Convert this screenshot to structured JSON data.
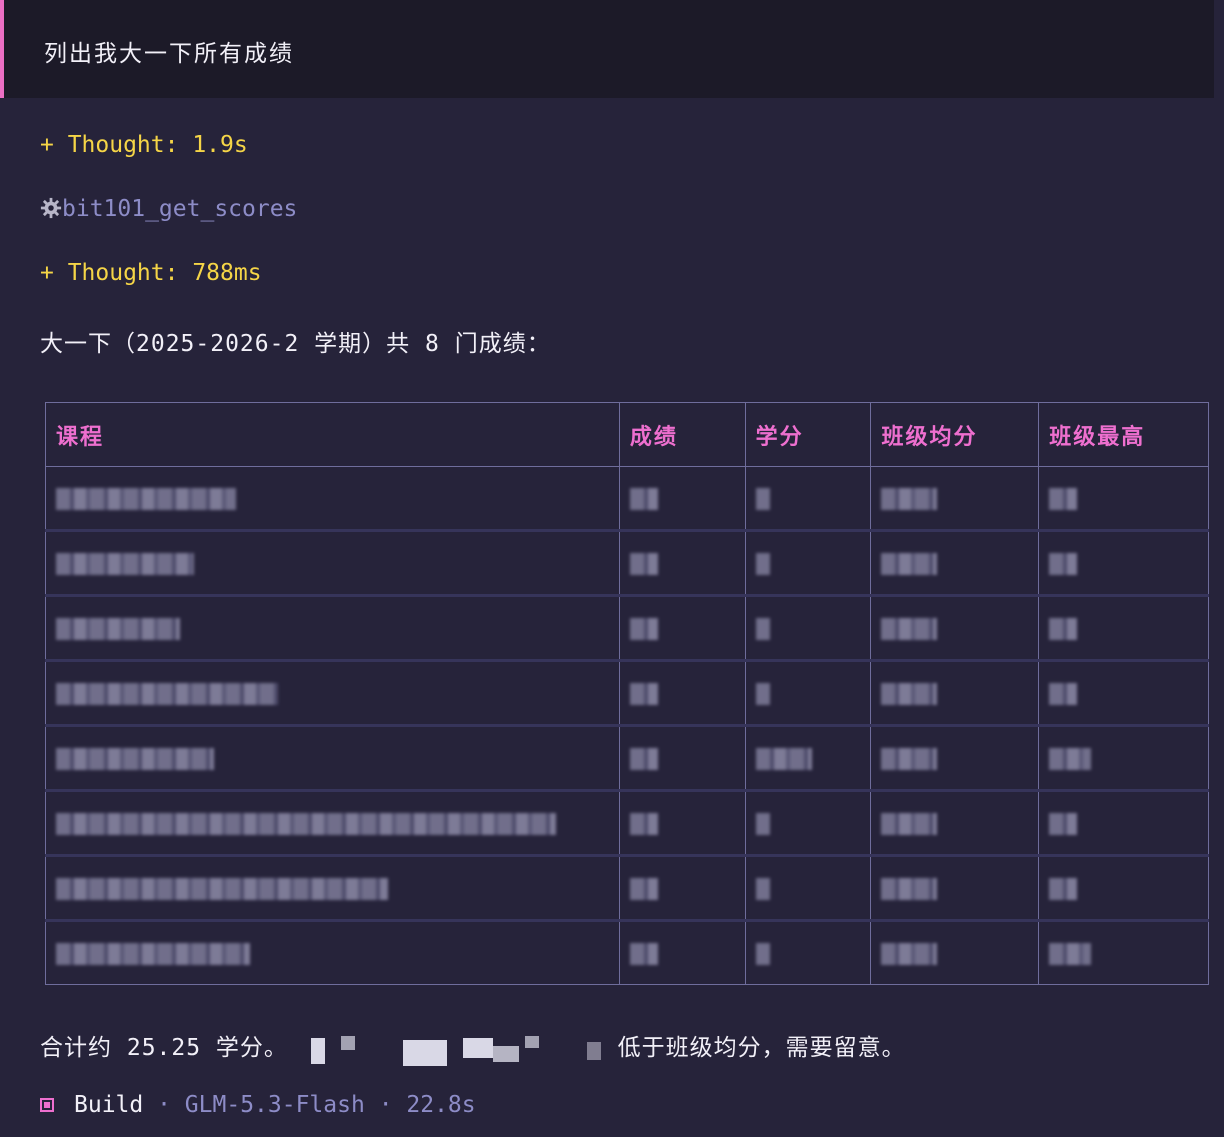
{
  "prompt": "列出我大一下所有成绩",
  "thought1": "+ Thought: 1.9s",
  "tool_call": "bit101_get_scores",
  "thought2": "+ Thought: 788ms",
  "summary": "大一下（2025-2026-2 学期）共 8 门成绩：",
  "table": {
    "headers": [
      "课程",
      "成绩",
      "学分",
      "班级均分",
      "班级最高"
    ]
  },
  "total_prefix": "合计约 25.25 学分。",
  "total_suffix": "低于班级均分，需要留意。",
  "footer": {
    "mode": "Build",
    "model": "· GLM-5.3-Flash",
    "duration": "· 22.8s"
  },
  "colors": {
    "accent": "#ec6fc4",
    "thought": "#f5d547",
    "tool": "#8d8cc7",
    "background": "#26233a"
  }
}
